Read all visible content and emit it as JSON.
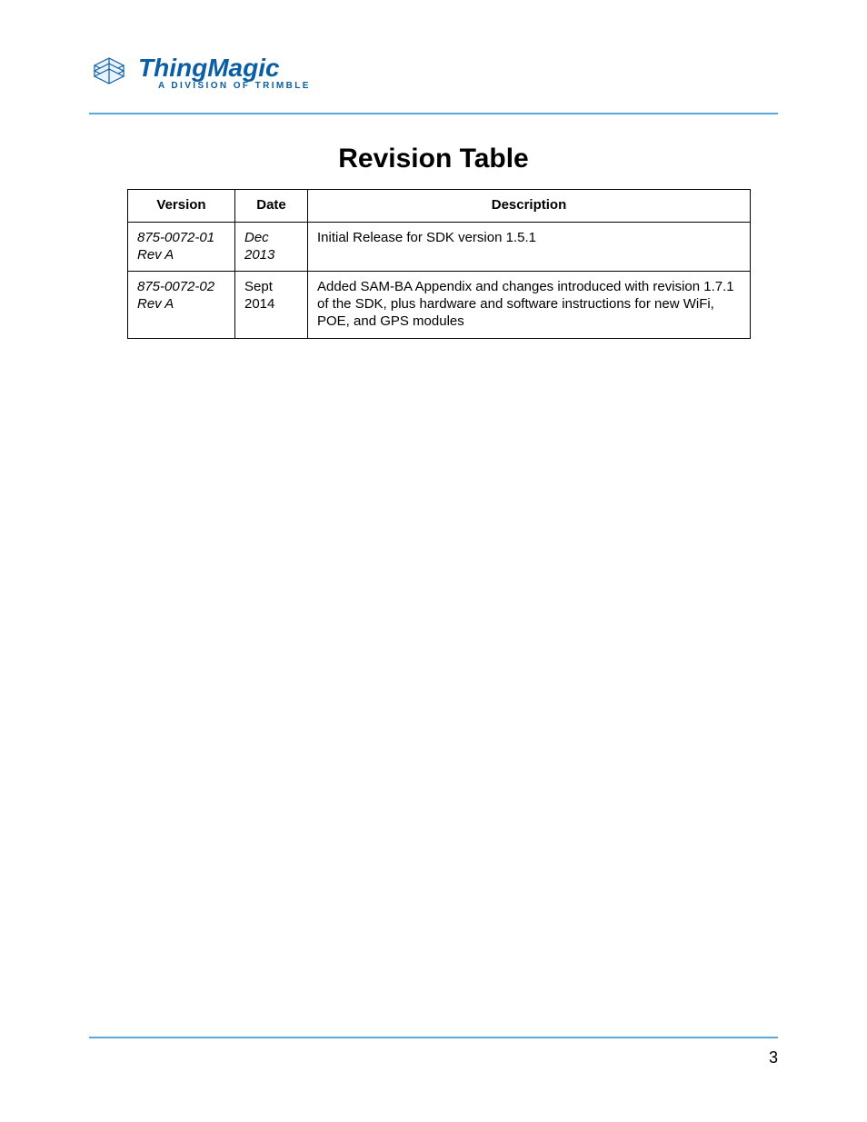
{
  "logo": {
    "main": "ThingMagic",
    "sub": "A DIVISION OF TRIMBLE"
  },
  "title": "Revision Table",
  "table": {
    "headers": {
      "version": "Version",
      "date": "Date",
      "description": "Description"
    },
    "rows": [
      {
        "version": "875-0072-01 Rev A",
        "date": "Dec 2013",
        "date_italic": true,
        "description": "Initial Release for SDK version 1.5.1"
      },
      {
        "version": "875-0072-02 Rev A",
        "date": "Sept 2014",
        "date_italic": false,
        "description": "Added SAM-BA Appendix and changes introduced with revision 1.7.1 of the SDK, plus hardware and software instructions for new WiFi, POE, and GPS modules"
      }
    ]
  },
  "page_number": "3"
}
